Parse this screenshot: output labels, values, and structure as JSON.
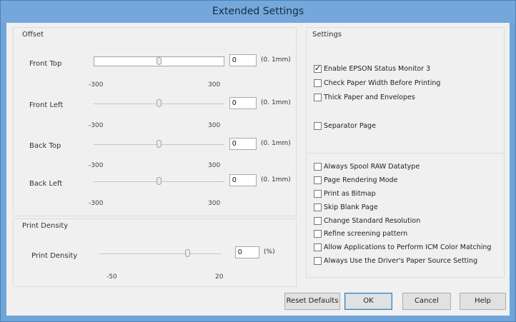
{
  "window": {
    "title": "Extended Settings"
  },
  "offset": {
    "title": "Offset",
    "rows": [
      {
        "label": "Front Top",
        "value": "0",
        "unit": "(0. 1mm)",
        "min": "-300",
        "max": "300"
      },
      {
        "label": "Front Left",
        "value": "0",
        "unit": "(0. 1mm)",
        "min": "-300",
        "max": "300"
      },
      {
        "label": "Back Top",
        "value": "0",
        "unit": "(0. 1mm)",
        "min": "-300",
        "max": "300"
      },
      {
        "label": "Back Left",
        "value": "0",
        "unit": "(0. 1mm)",
        "min": "-300",
        "max": "300"
      }
    ]
  },
  "print_density": {
    "title": "Print Density",
    "label": "Print Density",
    "value": "0",
    "unit": "(%)",
    "min": "-50",
    "max": "20"
  },
  "settings": {
    "title": "Settings",
    "group1": [
      {
        "label": "Enable EPSON Status Monitor 3",
        "checked": true
      },
      {
        "label": "Check Paper Width Before Printing",
        "checked": false
      },
      {
        "label": "Thick Paper and Envelopes",
        "checked": false
      },
      {
        "label": "Separator Page",
        "checked": false
      }
    ],
    "group2": [
      {
        "label": "Always Spool RAW Datatype",
        "checked": false
      },
      {
        "label": "Page Rendering Mode",
        "checked": false
      },
      {
        "label": "Print as Bitmap",
        "checked": false
      },
      {
        "label": "Skip Blank Page",
        "checked": false
      },
      {
        "label": "Change Standard Resolution",
        "checked": false
      },
      {
        "label": "Refine screening pattern",
        "checked": false
      },
      {
        "label": "Allow Applications to Perform ICM Color Matching",
        "checked": false
      },
      {
        "label": "Always Use the Driver's Paper Source Setting",
        "checked": false
      }
    ]
  },
  "buttons": {
    "reset": "Reset Defaults",
    "ok": "OK",
    "cancel": "Cancel",
    "help": "Help"
  }
}
